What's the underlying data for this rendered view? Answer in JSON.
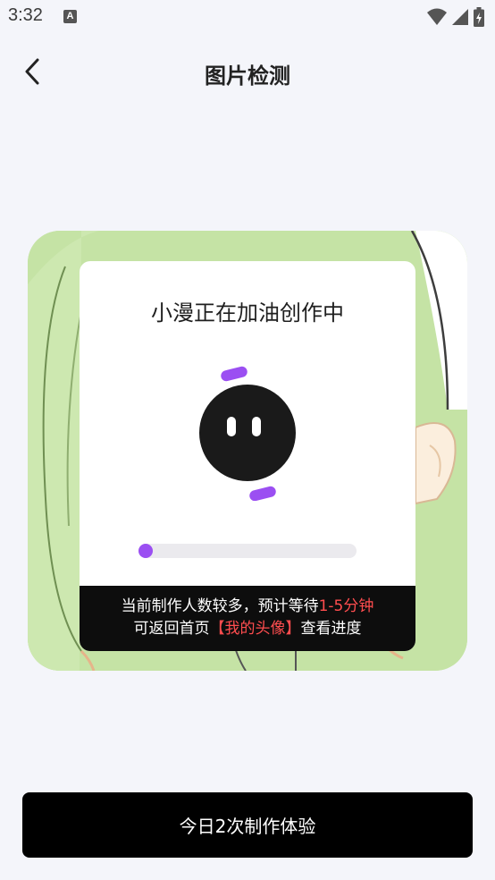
{
  "status_bar": {
    "time": "3:32",
    "notification_glyph": "A",
    "icons": [
      "wifi-icon",
      "signal-icon",
      "battery-icon"
    ]
  },
  "nav": {
    "back_icon": "chevron-left-icon",
    "title": "图片检测"
  },
  "card": {
    "title": "小漫正在加油创作中",
    "progress_fraction": 0.03,
    "notice": {
      "line1_prefix": "当前制作人数较多，预计等待",
      "line1_highlight": "1-5分钟",
      "line2_prefix": "可返回首页",
      "line2_highlight": "【我的头像】",
      "line2_suffix": "查看进度"
    }
  },
  "cta": {
    "label": "今日2次制作体验"
  },
  "colors": {
    "background": "#f4f5fa",
    "accent_purple": "#9b4ff2",
    "highlight_red": "#ff4d4f",
    "button_black": "#000000"
  }
}
